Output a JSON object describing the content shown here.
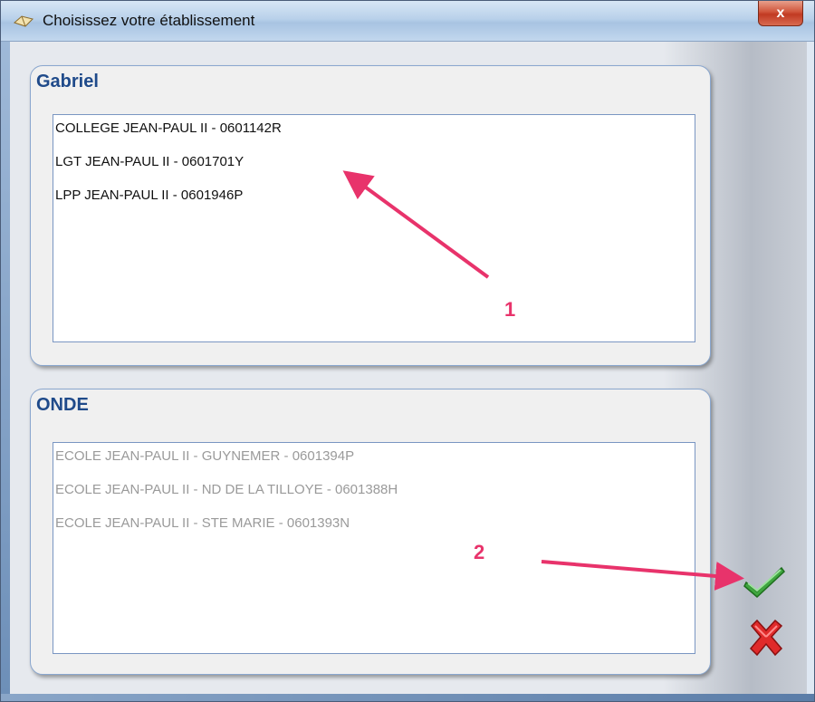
{
  "window": {
    "title": "Choisissez votre établissement",
    "close_label": "x"
  },
  "groups": [
    {
      "title": "Gabriel",
      "items": [
        "COLLEGE JEAN-PAUL II - 0601142R",
        "LGT JEAN-PAUL II - 0601701Y",
        "LPP JEAN-PAUL II - 0601946P"
      ]
    },
    {
      "title": "ONDE",
      "items": [
        "ECOLE JEAN-PAUL II - GUYNEMER - 0601394P",
        "ECOLE JEAN-PAUL II - ND DE LA TILLOYE - 0601388H",
        "ECOLE JEAN-PAUL II - STE MARIE - 0601393N"
      ]
    }
  ],
  "annotations": {
    "marker_1": "1",
    "marker_2": "2"
  },
  "buttons": {
    "ok_icon": "green-checkmark-icon",
    "cancel_icon": "red-x-icon"
  },
  "colors": {
    "group_title": "#1f4a8a",
    "annotation": "#e8336b",
    "disabled_text": "#9a9a9a"
  }
}
